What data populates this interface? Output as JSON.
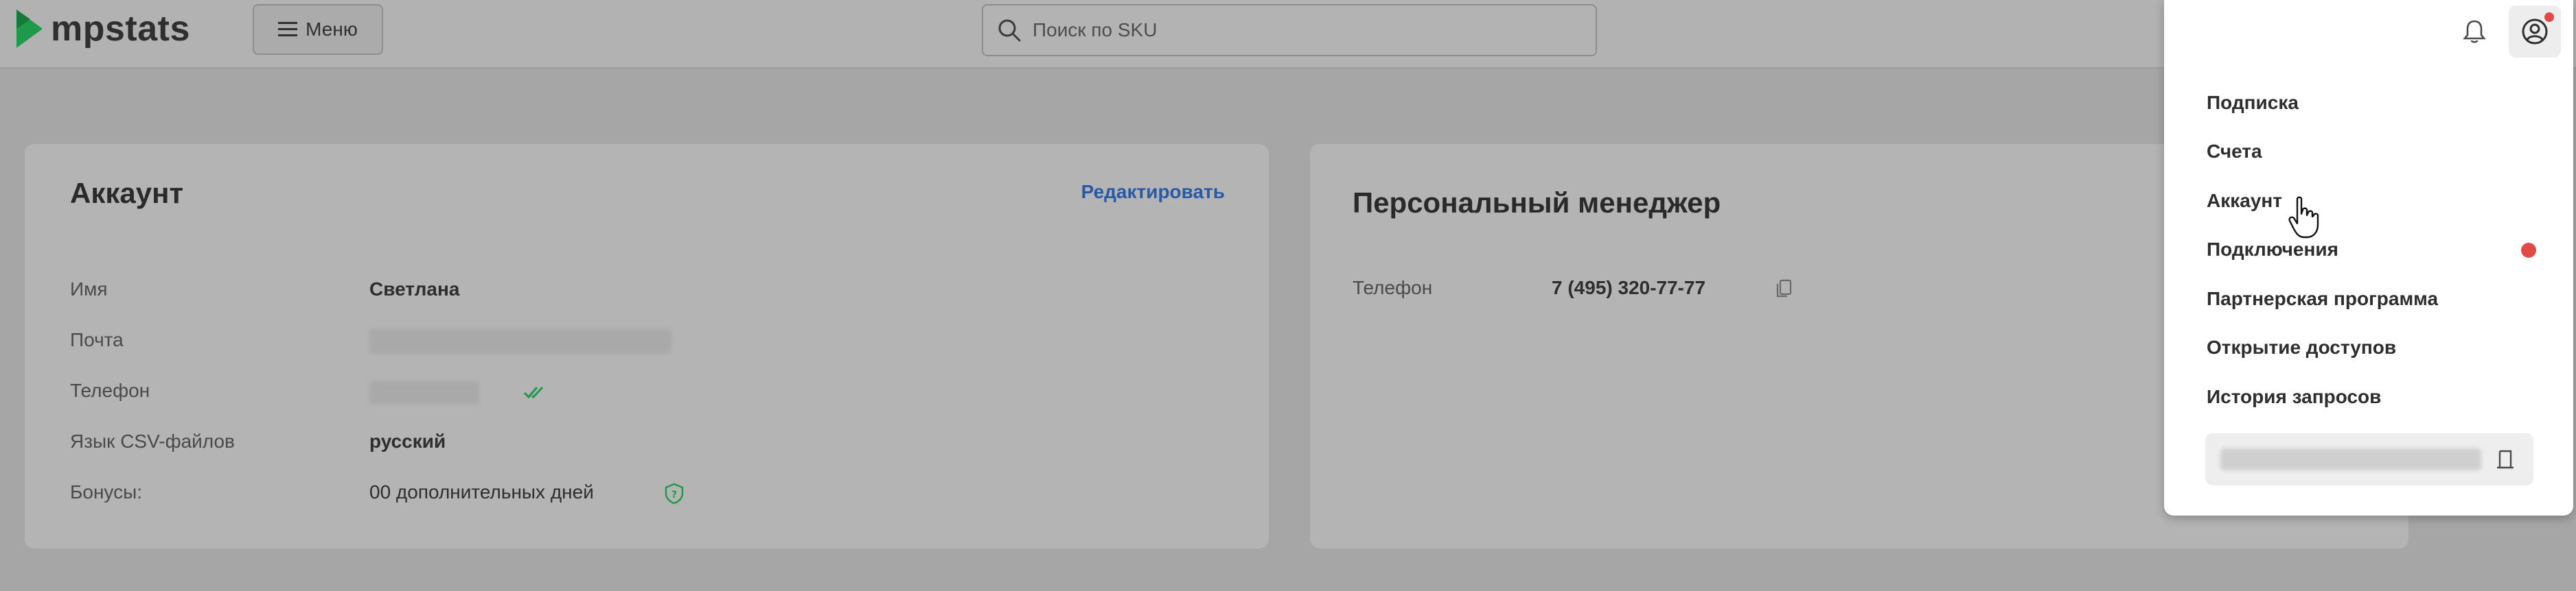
{
  "header": {
    "logo_text": "mpstats",
    "menu_label": "Меню",
    "search": {
      "placeholder": "Поиск по SKU",
      "value": ""
    },
    "icons": {
      "logo": "mpstats-logo-icon",
      "menu": "hamburger-icon",
      "search": "search-icon",
      "notifications": "bell-icon",
      "profile": "user-circle-icon"
    }
  },
  "account": {
    "title": "Аккаунт",
    "edit_label": "Редактировать",
    "rows": [
      {
        "label": "Имя",
        "value": "Светлана"
      },
      {
        "label": "Почта",
        "value": ""
      },
      {
        "label": "Телефон",
        "value": ""
      },
      {
        "label": "Язык CSV-файлов",
        "value": "русский"
      },
      {
        "label": "Бонусы:",
        "value": "00 дополнительных дней"
      }
    ],
    "icons": {
      "phone_verified": "double-check-icon",
      "bonus_help": "shield-question-icon"
    }
  },
  "manager": {
    "title": "Персональный менеджер",
    "phone_label": "Телефон",
    "phone_value": "7 (495) 320-77-77",
    "icons": {
      "copy": "copy-icon"
    }
  },
  "dropdown": {
    "items": [
      {
        "label": "Подписка"
      },
      {
        "label": "Счета"
      },
      {
        "label": "Аккаунт"
      },
      {
        "label": "Подключения",
        "badge": true
      },
      {
        "label": "Партнерская программа"
      },
      {
        "label": "Открытие доступов"
      },
      {
        "label": "История запросов"
      }
    ],
    "email_value": "",
    "icons": {
      "logout": "logout-icon"
    }
  },
  "colors": {
    "accent_green": "#1f9a4a",
    "link_blue": "#2a5aa6",
    "badge_red": "#e24a4a"
  }
}
